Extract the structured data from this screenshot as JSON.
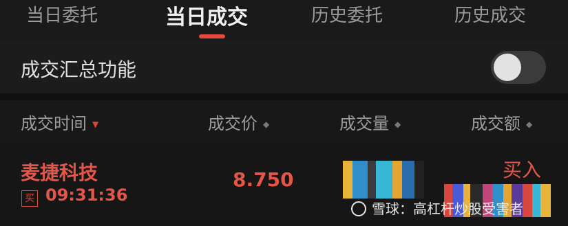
{
  "tabs": [
    {
      "label": "当日委托"
    },
    {
      "label": "当日成交"
    },
    {
      "label": "历史委托"
    },
    {
      "label": "历史成交"
    }
  ],
  "summary": {
    "label": "成交汇总功能",
    "toggle_on": false
  },
  "columns": [
    "成交时间",
    "成交价",
    "成交量",
    "成交额"
  ],
  "trade": {
    "name": "麦捷科技",
    "badge": "买",
    "time": "09:31:36",
    "price": "8.750",
    "side": "买入"
  },
  "watermark": {
    "text": "雪球：高杠杆炒股受害者"
  },
  "colors": {
    "accent": "#e8473e",
    "red_text": "#e55548",
    "background": "#161616"
  }
}
